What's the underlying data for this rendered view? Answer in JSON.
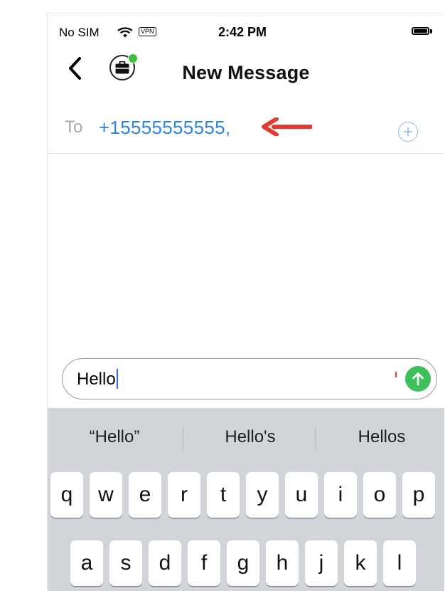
{
  "status_bar": {
    "carrier": "No SIM",
    "vpn": "VPN",
    "time": "2:42 PM"
  },
  "nav": {
    "title": "New Message"
  },
  "recipient": {
    "label": "To",
    "value": "+15555555555,"
  },
  "compose": {
    "text": "Hello"
  },
  "suggestions": [
    "“Hello”",
    "Hello's",
    "Hellos"
  ],
  "keyboard": {
    "row1": [
      "q",
      "w",
      "e",
      "r",
      "t",
      "y",
      "u",
      "i",
      "o",
      "p"
    ],
    "row2": [
      "a",
      "s",
      "d",
      "f",
      "g",
      "h",
      "j",
      "k",
      "l"
    ]
  },
  "colors": {
    "link_blue": "#2f85e4",
    "send_green": "#3cc15a",
    "arrow_red": "#e23b2f",
    "keyboard_bg": "#d1d4d9"
  },
  "icons": [
    "wifi-icon",
    "battery-icon",
    "back-chevron-icon",
    "briefcase-icon",
    "add-contact-icon",
    "send-arrow-icon",
    "red-arrow-annotation-icon"
  ]
}
